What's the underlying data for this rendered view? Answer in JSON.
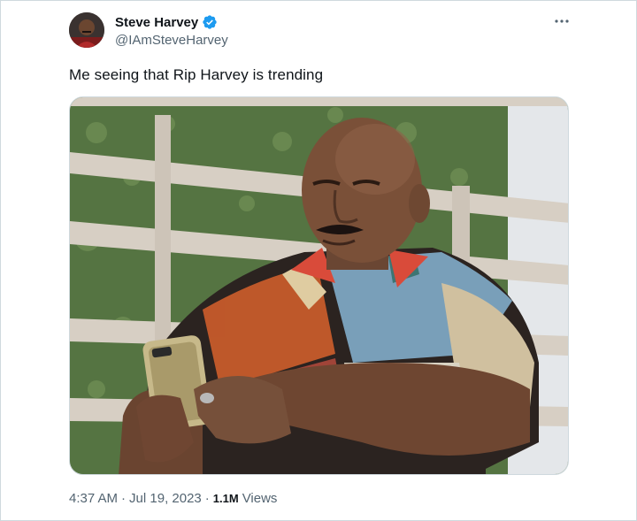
{
  "tweet": {
    "author_name": "Steve Harvey",
    "author_handle": "@IAmSteveHarvey",
    "verified": true,
    "text": "Me seeing that Rip Harvey is trending",
    "time": "4:37 AM",
    "date": "Jul 19, 2023",
    "separator": "·",
    "views_count": "1.1M",
    "views_label": "Views"
  },
  "icons": {
    "verified": "verified-badge-icon",
    "more": "more-dots-icon"
  },
  "colors": {
    "verified_blue": "#1d9bf0",
    "secondary_text": "#536471",
    "primary_text": "#0f1419",
    "border": "#cfd9de"
  }
}
